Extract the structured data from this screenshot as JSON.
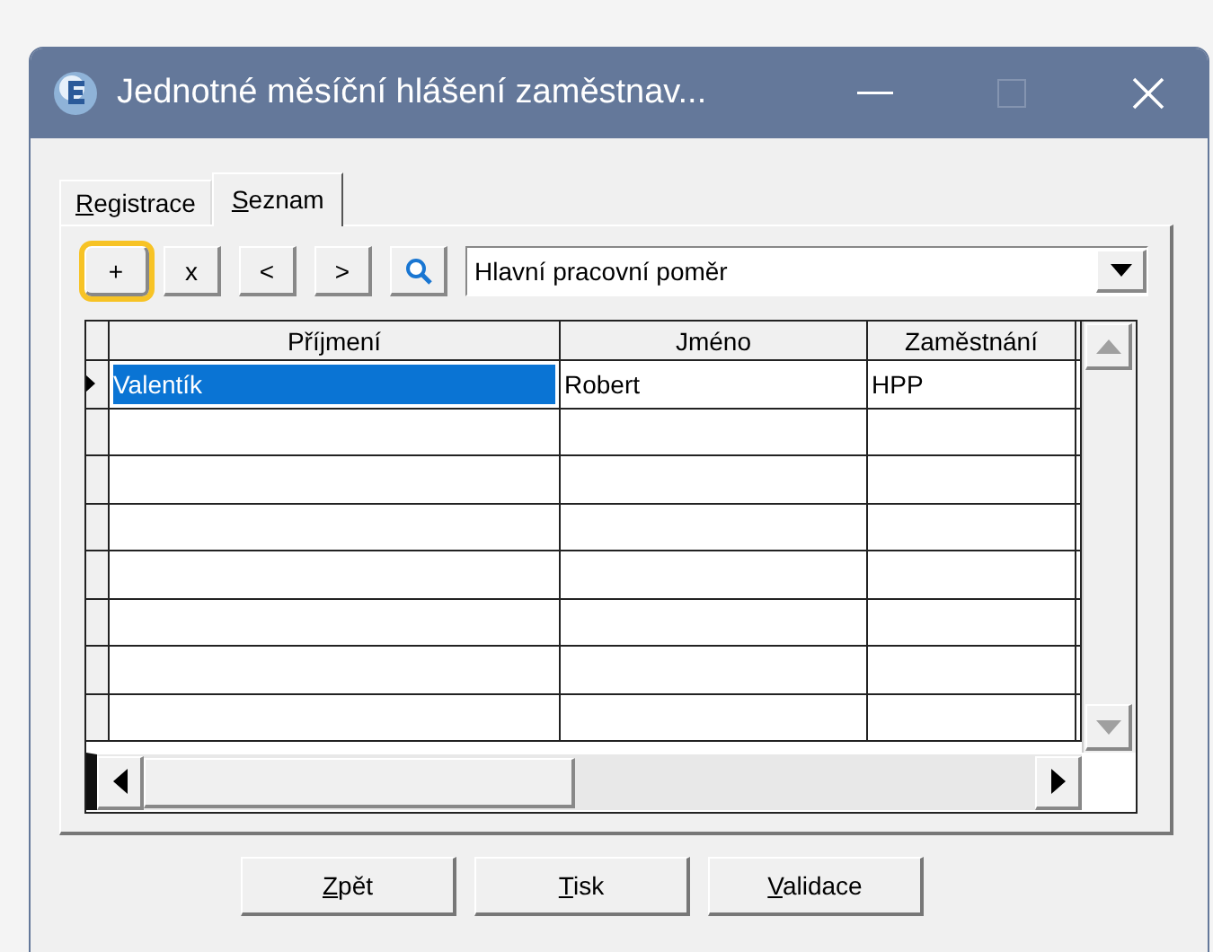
{
  "window": {
    "title": "Jednotné měsíční hlášení zaměstnav..."
  },
  "tabs": [
    {
      "label": "Registrace",
      "selected": false
    },
    {
      "label": "Seznam",
      "selected": true
    }
  ],
  "toolbar": [
    {
      "kind": "text",
      "label": "+",
      "focused": true
    },
    {
      "kind": "text",
      "label": "x",
      "focused": false
    },
    {
      "kind": "text",
      "label": "<",
      "focused": false
    },
    {
      "kind": "text",
      "label": ">",
      "focused": false
    },
    {
      "kind": "search",
      "focused": false
    }
  ],
  "filter": {
    "value": "Hlavní pracovní poměr"
  },
  "table": {
    "columns": [
      "Příjmení",
      "Jméno",
      "Zaměstnání"
    ],
    "rows": [
      {
        "cells": [
          "Valentík",
          "Robert",
          "HPP"
        ],
        "selected": true
      }
    ]
  },
  "buttons": [
    {
      "label": "Zpět"
    },
    {
      "label": "Tisk"
    },
    {
      "label": "Validace"
    }
  ]
}
